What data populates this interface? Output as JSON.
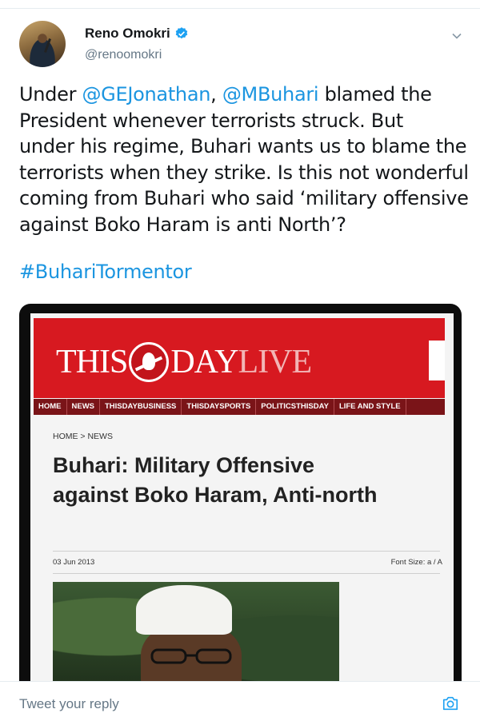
{
  "author": {
    "name": "Reno Omokri",
    "handle": "@renoomokri"
  },
  "tweet": {
    "line1_a": "Under ",
    "mention1": "@GEJonathan",
    "line1_b": ", ",
    "mention2": "@MBuhari",
    "line1_c": " blamed the",
    "line2": "President whenever terrorists struck. But",
    "line3": "under his regime, Buhari wants us to blame the",
    "line4": "terrorists when they strike. Is this not wonderful",
    "line5": "coming from Buhari who said ‘military offensive",
    "line6": "against Boko Haram is anti North’?",
    "hashtag": "#BuhariTormentor"
  },
  "media": {
    "logo_this": "THIS",
    "logo_day": "DAY",
    "logo_live": "LIVE",
    "nav": [
      "HOME",
      "NEWS",
      "THISDAYBUSINESS",
      "THISDAYSPORTS",
      "POLITICSTHISDAY",
      "LIFE AND STYLE"
    ],
    "breadcrumb": "HOME > NEWS",
    "headline": "Buhari: Military Offensive against Boko Haram, Anti-north",
    "date": "03 Jun 2013",
    "font_size_label": "Font Size: a / A"
  },
  "reply": {
    "placeholder": "Tweet your reply"
  },
  "colors": {
    "link": "#1b95e0",
    "masthead": "#d71920",
    "verified": "#1da1f2"
  },
  "icons": [
    "verified-badge-icon",
    "chevron-down-icon",
    "camera-icon"
  ]
}
